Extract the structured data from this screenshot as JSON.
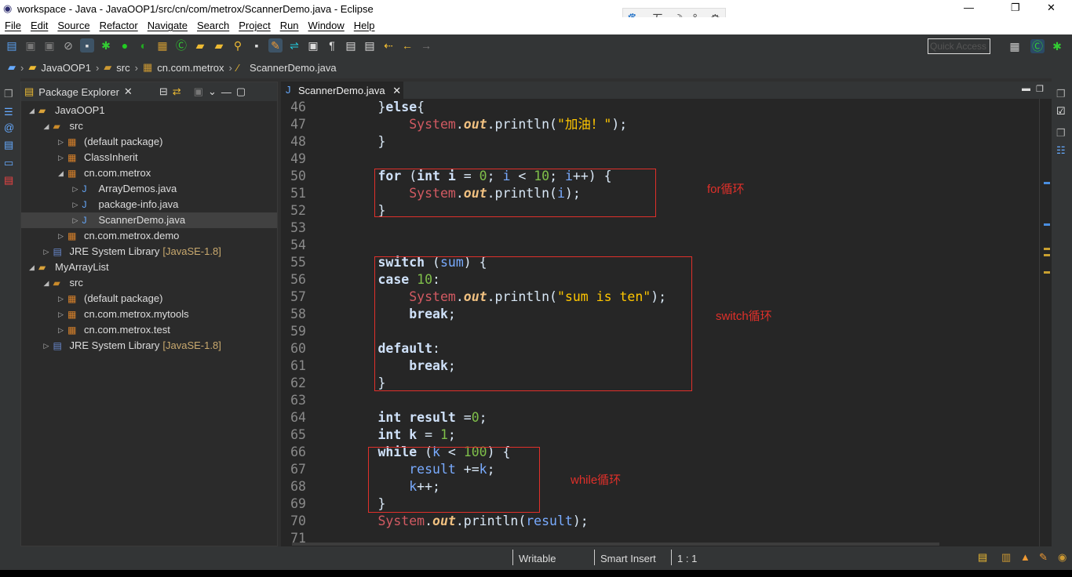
{
  "window": {
    "title": "workspace - Java - JavaOOP1/src/cn/com/metrox/ScannerDemo.java - Eclipse",
    "controls": [
      "—",
      "❐",
      "✕"
    ]
  },
  "ime": [
    "🐾",
    "五",
    "☽",
    "°,",
    "⚙"
  ],
  "menu": [
    "File",
    "Edit",
    "Source",
    "Refactor",
    "Navigate",
    "Search",
    "Project",
    "Run",
    "Window",
    "Help"
  ],
  "toolbar": {
    "quick_access_placeholder": "Quick Access"
  },
  "breadcrumb": [
    "JavaOOP1",
    "src",
    "cn.com.metrox",
    "ScannerDemo.java"
  ],
  "package_explorer": {
    "title": "Package Explorer",
    "items": [
      {
        "label": "JavaOOP1",
        "level": 0,
        "expanded": true,
        "icon": "project-icon"
      },
      {
        "label": "src",
        "level": 1,
        "expanded": true,
        "icon": "source-folder-icon"
      },
      {
        "label": "(default package)",
        "level": 2,
        "expanded": false,
        "icon": "package-icon"
      },
      {
        "label": "ClassInherit",
        "level": 2,
        "expanded": false,
        "icon": "package-icon"
      },
      {
        "label": "cn.com.metrox",
        "level": 2,
        "expanded": true,
        "icon": "package-icon"
      },
      {
        "label": "ArrayDemos.java",
        "level": 3,
        "expanded": false,
        "icon": "java-file-icon"
      },
      {
        "label": "package-info.java",
        "level": 3,
        "expanded": false,
        "icon": "java-file-icon"
      },
      {
        "label": "ScannerDemo.java",
        "level": 3,
        "expanded": false,
        "icon": "java-file-icon",
        "selected": true
      },
      {
        "label": "cn.com.metrox.demo",
        "level": 2,
        "expanded": false,
        "icon": "package-icon"
      },
      {
        "label": "JRE System Library",
        "suffix": "[JavaSE-1.8]",
        "level": 1,
        "expanded": false,
        "icon": "library-icon"
      },
      {
        "label": "MyArrayList",
        "level": 0,
        "expanded": true,
        "icon": "project-icon"
      },
      {
        "label": "src",
        "level": 1,
        "expanded": true,
        "icon": "source-folder-icon"
      },
      {
        "label": "(default package)",
        "level": 2,
        "expanded": false,
        "icon": "package-icon"
      },
      {
        "label": "cn.com.metrox.mytools",
        "level": 2,
        "expanded": false,
        "icon": "package-icon"
      },
      {
        "label": "cn.com.metrox.test",
        "level": 2,
        "expanded": false,
        "icon": "package-icon"
      },
      {
        "label": "JRE System Library",
        "suffix": "[JavaSE-1.8]",
        "level": 1,
        "expanded": false,
        "icon": "library-icon"
      }
    ]
  },
  "editor": {
    "tab": "ScannerDemo.java",
    "lines": [
      {
        "n": "46",
        "t": [
          [
            "        }",
            ""
          ],
          [
            "else",
            "kw"
          ],
          [
            "{",
            ""
          ]
        ]
      },
      {
        "n": "47",
        "t": [
          [
            "            ",
            ""
          ],
          [
            "System",
            "sys"
          ],
          [
            ".",
            ""
          ],
          [
            "out",
            "out"
          ],
          [
            ".println(",
            ""
          ],
          [
            "\"加油！\"",
            "str"
          ],
          [
            ");",
            ""
          ]
        ]
      },
      {
        "n": "48",
        "t": [
          [
            "        }",
            ""
          ]
        ]
      },
      {
        "n": "49",
        "t": []
      },
      {
        "n": "50",
        "t": [
          [
            "        ",
            ""
          ],
          [
            "for",
            "kw"
          ],
          [
            " (",
            ""
          ],
          [
            "int",
            "kw"
          ],
          [
            " ",
            ""
          ],
          [
            "i",
            "kw"
          ],
          [
            " = ",
            ""
          ],
          [
            "0",
            "num"
          ],
          [
            "; ",
            ""
          ],
          [
            "i",
            "var"
          ],
          [
            " < ",
            ""
          ],
          [
            "10",
            "num"
          ],
          [
            "; ",
            ""
          ],
          [
            "i",
            "var"
          ],
          [
            "++) {",
            ""
          ]
        ]
      },
      {
        "n": "51",
        "t": [
          [
            "            ",
            ""
          ],
          [
            "System",
            "sys"
          ],
          [
            ".",
            ""
          ],
          [
            "out",
            "out"
          ],
          [
            ".println(",
            ""
          ],
          [
            "i",
            "var"
          ],
          [
            ");",
            ""
          ]
        ]
      },
      {
        "n": "52",
        "t": [
          [
            "        }",
            ""
          ]
        ]
      },
      {
        "n": "53",
        "t": []
      },
      {
        "n": "54",
        "t": []
      },
      {
        "n": "55",
        "t": [
          [
            "        ",
            ""
          ],
          [
            "switch",
            "kw"
          ],
          [
            " (",
            ""
          ],
          [
            "sum",
            "var"
          ],
          [
            ") {",
            ""
          ]
        ]
      },
      {
        "n": "56",
        "t": [
          [
            "        ",
            ""
          ],
          [
            "case",
            "kw"
          ],
          [
            " ",
            ""
          ],
          [
            "10",
            "num"
          ],
          [
            ":",
            ""
          ]
        ]
      },
      {
        "n": "57",
        "t": [
          [
            "            ",
            ""
          ],
          [
            "System",
            "sys"
          ],
          [
            ".",
            ""
          ],
          [
            "out",
            "out"
          ],
          [
            ".println(",
            ""
          ],
          [
            "\"sum is ten\"",
            "str"
          ],
          [
            ");",
            ""
          ]
        ]
      },
      {
        "n": "58",
        "t": [
          [
            "            ",
            ""
          ],
          [
            "break",
            "kw"
          ],
          [
            ";",
            ""
          ]
        ]
      },
      {
        "n": "59",
        "t": []
      },
      {
        "n": "60",
        "t": [
          [
            "        ",
            ""
          ],
          [
            "default",
            "kw"
          ],
          [
            ":",
            ""
          ]
        ]
      },
      {
        "n": "61",
        "t": [
          [
            "            ",
            ""
          ],
          [
            "break",
            "kw"
          ],
          [
            ";",
            ""
          ]
        ]
      },
      {
        "n": "62",
        "t": [
          [
            "        }",
            ""
          ]
        ]
      },
      {
        "n": "63",
        "t": []
      },
      {
        "n": "64",
        "t": [
          [
            "        ",
            ""
          ],
          [
            "int",
            "kw"
          ],
          [
            " ",
            ""
          ],
          [
            "result",
            "kw"
          ],
          [
            " =",
            ""
          ],
          [
            "0",
            "num"
          ],
          [
            ";",
            ""
          ]
        ]
      },
      {
        "n": "65",
        "t": [
          [
            "        ",
            ""
          ],
          [
            "int",
            "kw"
          ],
          [
            " ",
            ""
          ],
          [
            "k",
            "kw"
          ],
          [
            " = ",
            ""
          ],
          [
            "1",
            "num"
          ],
          [
            ";",
            ""
          ]
        ]
      },
      {
        "n": "66",
        "t": [
          [
            "        ",
            ""
          ],
          [
            "while",
            "kw"
          ],
          [
            " (",
            ""
          ],
          [
            "k",
            "var"
          ],
          [
            " < ",
            ""
          ],
          [
            "100",
            "num"
          ],
          [
            ") {",
            ""
          ]
        ]
      },
      {
        "n": "67",
        "t": [
          [
            "            ",
            ""
          ],
          [
            "result",
            "var"
          ],
          [
            " +=",
            ""
          ],
          [
            "k",
            "var"
          ],
          [
            ";",
            ""
          ]
        ]
      },
      {
        "n": "68",
        "t": [
          [
            "            ",
            ""
          ],
          [
            "k",
            "var"
          ],
          [
            "++;",
            ""
          ]
        ]
      },
      {
        "n": "69",
        "t": [
          [
            "        }",
            ""
          ]
        ]
      },
      {
        "n": "70",
        "t": [
          [
            "        ",
            ""
          ],
          [
            "System",
            "sys"
          ],
          [
            ".",
            ""
          ],
          [
            "out",
            "out"
          ],
          [
            ".println(",
            ""
          ],
          [
            "result",
            "var"
          ],
          [
            ");",
            ""
          ]
        ]
      },
      {
        "n": "71",
        "t": []
      }
    ],
    "annotations": [
      "for循环",
      "switch循环",
      "while循环"
    ],
    "annotation_color": "#e0302a"
  },
  "status": {
    "writable": "Writable",
    "insert_mode": "Smart Insert",
    "position": "1 : 1"
  }
}
